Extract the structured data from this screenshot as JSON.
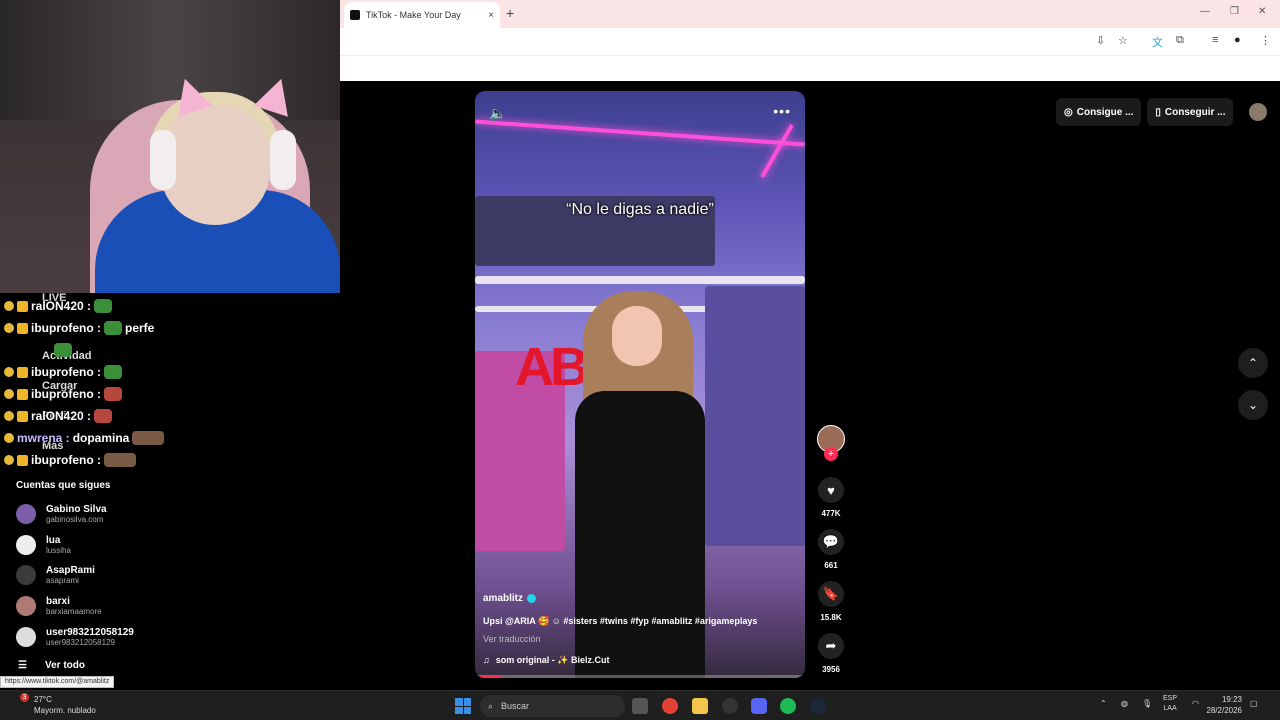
{
  "browser": {
    "tab_title": "TikTok - Make Your Day",
    "new_tab": "+",
    "tab_close": "×"
  },
  "tiktok": {
    "caption_overlay": "“No le digas a nadie”",
    "author": "amablitz",
    "description": "Upsi @ARIA 🥰 ☺ #sisters #twins #fyp #amablitz #arigameplays",
    "translate": "Ver traducción",
    "music": "som original - ✨ Bielz.Cut",
    "likes": "477K",
    "comments": "661",
    "saves": "15.8K",
    "shares": "3956",
    "top_btn_1": "Consigue ...",
    "top_btn_2": "Conseguir ...",
    "progress": 0.08
  },
  "chat": [
    {
      "name": "ralON420 :",
      "text": ""
    },
    {
      "name": "ibuprofeno :",
      "text": "perfe"
    },
    {
      "name": "",
      "text": ""
    },
    {
      "name": "ibuprofeno :",
      "text": ""
    },
    {
      "name": "ibuprofeno :",
      "text": ""
    },
    {
      "name": "ralON420 :",
      "text": ""
    },
    {
      "name": "mwrena :",
      "text": "dopamina"
    },
    {
      "name": "ibuprofeno :",
      "text": ""
    }
  ],
  "sidebar_ghost": {
    "live": "LIVE",
    "activity": "Actividad",
    "upload": "Cargar",
    "profile": "Perfil",
    "more": "Más"
  },
  "following": {
    "heading": "Cuentas que sigues",
    "items": [
      {
        "name": "Gabino Silva",
        "user": "gabinosilva.com"
      },
      {
        "name": "lua",
        "user": "lussiha"
      },
      {
        "name": "AsapRami",
        "user": "asaprami"
      },
      {
        "name": "barxi",
        "user": "barxiamaamore"
      },
      {
        "name": "user983212058129",
        "user": "user983212058129"
      }
    ],
    "see_all": "Ver todo"
  },
  "status_url": "https://www.tiktok.com/@amablitz",
  "taskbar": {
    "weather_temp": "27°C",
    "weather_desc": "Mayorm. nublado",
    "weather_badge": "3",
    "search_placeholder": "Buscar",
    "lang_1": "ESP",
    "lang_2": "LAA",
    "time": "19:23",
    "date": "28/2/2026"
  }
}
